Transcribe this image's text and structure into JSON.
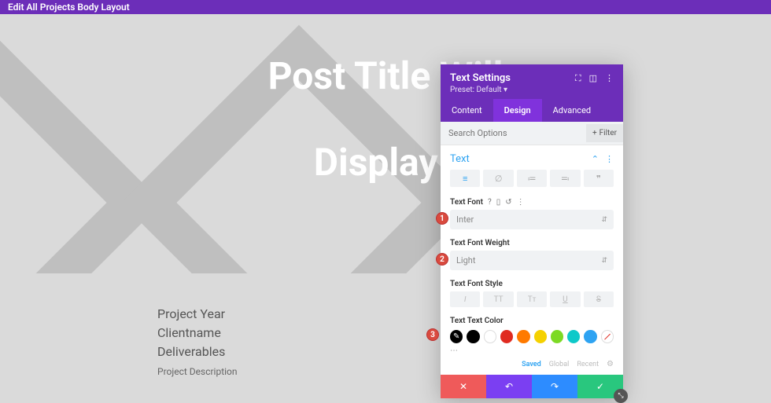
{
  "topbar": {
    "title": "Edit All Projects Body Layout"
  },
  "hero": {
    "line1": "Post Title Will",
    "line2": "Display l"
  },
  "content": {
    "line1": "Project Year",
    "line2": "Clientname",
    "line3": "Deliverables",
    "desc": "Project Description"
  },
  "panel": {
    "title": "Text Settings",
    "preset": "Preset: Default",
    "tabs": {
      "content": "Content",
      "design": "Design",
      "advanced": "Advanced"
    },
    "search_placeholder": "Search Options",
    "filter": "Filter",
    "section": "Text",
    "font_label": "Text Font",
    "font_value": "Inter",
    "weight_label": "Text Font Weight",
    "weight_value": "Light",
    "style_label": "Text Font Style",
    "color_label": "Text Text Color",
    "palette": {
      "saved": "Saved",
      "global": "Global",
      "recent": "Recent"
    },
    "badges": {
      "one": "1",
      "two": "2",
      "three": "3"
    }
  }
}
